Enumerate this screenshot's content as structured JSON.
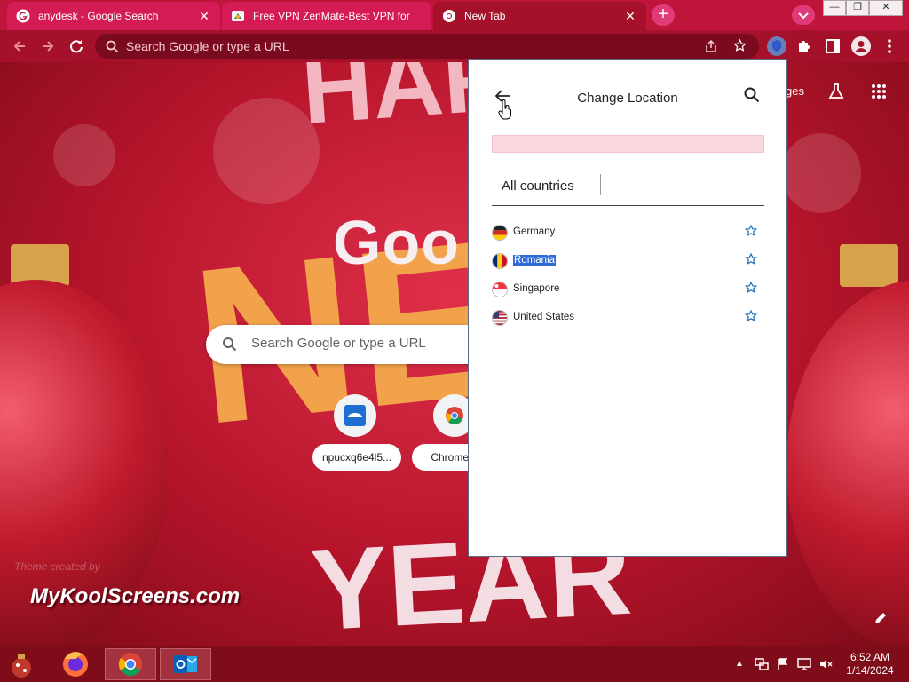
{
  "tabs": [
    {
      "title": "anydesk - Google Search",
      "state": "inactive",
      "favicon": "google-g-icon"
    },
    {
      "title": "Free VPN ZenMate-Best VPN for",
      "state": "inactive",
      "favicon": "zenmate-icon"
    },
    {
      "title": "New Tab",
      "state": "active",
      "favicon": "chrome-icon"
    }
  ],
  "toolbar": {
    "omnibox_placeholder": "Search Google or type a URL"
  },
  "ntp": {
    "search_placeholder": "Search Google or type a URL",
    "logo_text": "Goo",
    "shortcuts": [
      {
        "label": "npucxq6e4l5...",
        "icon": "anydesk-like-icon"
      },
      {
        "label": "Chrome W",
        "icon": "chrome-web-store-icon"
      }
    ],
    "header_links_fragment": "ges",
    "theme_credit": "Theme created by",
    "watermark": "MyKoolScreens.com",
    "bg_text_top": "HAP",
    "bg_text_mid": "NE",
    "bg_text_bottom": "YEAR"
  },
  "vpn_popup": {
    "title": "Change Location",
    "tab_label": "All countries",
    "countries": [
      {
        "name": "Germany",
        "flag": "germany-flag-icon",
        "selected": false
      },
      {
        "name": "Romania",
        "flag": "romania-flag-icon",
        "selected": true
      },
      {
        "name": "Singapore",
        "flag": "singapore-flag-icon",
        "selected": false
      },
      {
        "name": "United States",
        "flag": "us-flag-icon",
        "selected": false
      }
    ]
  },
  "taskbar": {
    "apps": [
      "christmas-start-icon",
      "firefox-icon",
      "chrome-icon",
      "outlook-icon"
    ],
    "time": "6:52 AM",
    "date": "1/14/2024"
  },
  "colors": {
    "tabstrip": "#c0153a",
    "toolbar": "#a5102a",
    "selection": "#2e6bd6",
    "star": "#1d6fb8"
  }
}
